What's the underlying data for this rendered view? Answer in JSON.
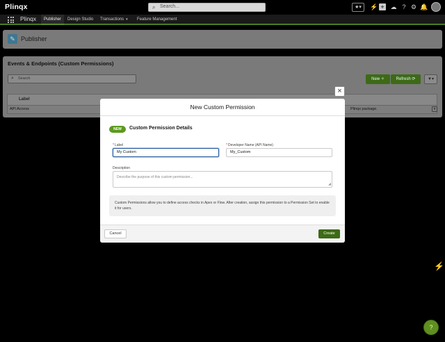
{
  "topbar": {
    "logo": "Plinqx",
    "search_placeholder": "Search...",
    "favorites_icon": "★▾"
  },
  "navbar": {
    "app_name": "Plinqx",
    "tabs": [
      {
        "label": "Publisher",
        "active": true
      },
      {
        "label": "Design Studio",
        "active": false
      },
      {
        "label": "Transactions",
        "active": false,
        "has_dropdown": true
      },
      {
        "label": "Feature Management",
        "active": false
      }
    ]
  },
  "page_header": {
    "title": "Publisher",
    "icon": "publisher-icon"
  },
  "list_view": {
    "title": "Events & Endpoints (Custom Permissions)",
    "search_placeholder": "Search",
    "new_button": "New",
    "refresh_button": "Refresh",
    "columns": [
      "Label",
      "",
      ""
    ],
    "rows": [
      {
        "label": "API Access",
        "description_end": "Plinqx package."
      }
    ]
  },
  "modal": {
    "title": "New Custom Permission",
    "badge": "NEW",
    "section_title": "Custom Permission Details",
    "label_field": {
      "label": "Label",
      "value": "My Custom",
      "required": true
    },
    "developer_name_field": {
      "label": "Developer Name (API Name)",
      "value": "My_Custom",
      "required": true
    },
    "description_field": {
      "label": "Description",
      "placeholder": "Describe the purpose of this custom permission..."
    },
    "info_text": "Custom Permissions allow you to define access checks in Apex or Flow. After creation, assign this permission to a Permission Set to enable it for users.",
    "cancel_button": "Cancel",
    "create_button": "Create"
  },
  "colors": {
    "brand_green": "#3e6a17",
    "badge_green": "#5c9a1e",
    "focus_blue": "#1b5297",
    "overlay": "#000000"
  }
}
